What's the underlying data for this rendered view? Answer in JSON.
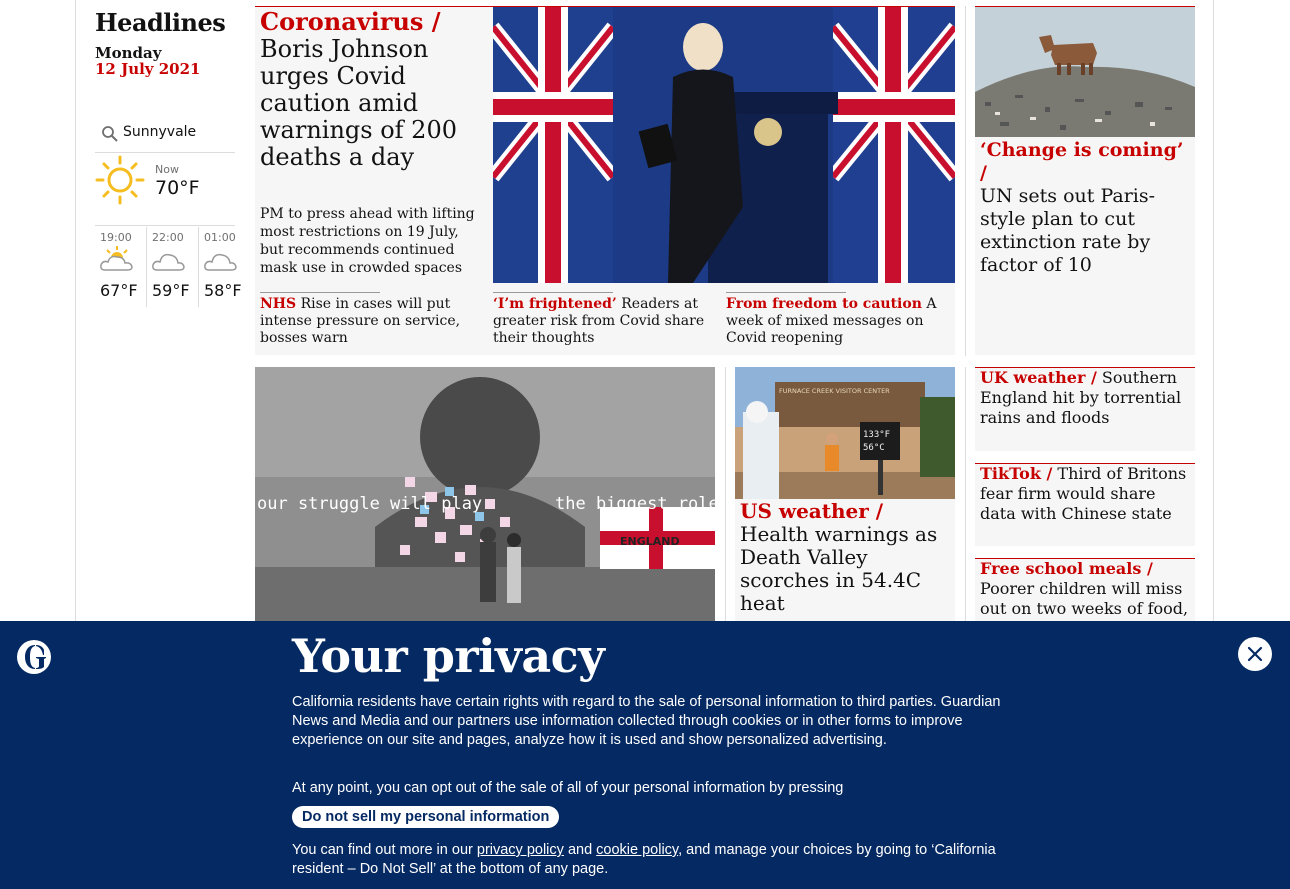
{
  "sidebar": {
    "title": "Headlines",
    "day": "Monday",
    "date": "12 July 2021",
    "location": "Sunnyvale",
    "now_label": "Now",
    "now_temp": "70°F",
    "now_icon": "sunny-icon",
    "forecast": [
      {
        "time": "19:00",
        "temp": "67°F",
        "icon": "partly-cloudy-icon"
      },
      {
        "time": "22:00",
        "temp": "59°F",
        "icon": "cloudy-night-icon"
      },
      {
        "time": "01:00",
        "temp": "58°F",
        "icon": "cloudy-night-icon"
      }
    ]
  },
  "main": {
    "lead": {
      "kicker": "Coronavirus /",
      "headline": "Boris Johnson urges Covid caution amid warnings of 200 deaths a day",
      "standfirst": "PM to press ahead with lifting most restrictions on 19 July, but recommends continued mask use in crowded spaces"
    },
    "sublinks": [
      {
        "kicker": "NHS",
        "text": "Rise in cases will put intense pressure on service, bosses warn"
      },
      {
        "kicker": "‘I’m frightened’",
        "text": "Readers at greater risk from Covid share their thoughts"
      },
      {
        "kicker": "From freedom to caution",
        "text": "A week of mixed messages on Covid reopening"
      }
    ],
    "mural_text_left": "our struggle will play",
    "mural_text_right": "the biggest role in your",
    "flag_text": "ENGLAND",
    "us_weather": {
      "kicker": "US weather /",
      "headline": "Health warnings as Death Valley scorches in 54.4C heat",
      "sign_text": "FURNACE CREEK VISITOR CENTER",
      "thermo_f": "133°F",
      "thermo_c": "56°C"
    }
  },
  "right": {
    "un": {
      "kicker": "‘Change is coming’ /",
      "headline": "UN sets out Paris-style plan to cut extinction rate by factor of 10"
    },
    "items": [
      {
        "kicker": "UK weather /",
        "headline": "Southern England hit by torrential rains and floods"
      },
      {
        "kicker": "TikTok /",
        "headline": "Third of Britons fear firm would share data with Chinese state"
      },
      {
        "kicker": "Free school meals /",
        "headline": "Poorer children will miss out on two weeks of food, says"
      }
    ]
  },
  "privacy": {
    "title": "Your privacy",
    "para1": "California residents have certain rights with regard to the sale of personal information to third parties. Guardian News and Media and our partners use information collected through cookies or in other forms to improve experience on our site and pages, analyze how it is used and show personalized advertising.",
    "para2": "At any point, you can opt out of the sale of all of your personal information by pressing",
    "button": "Do not sell my personal information",
    "para3_a": "You can find out more in our",
    "privacy_link": "privacy policy",
    "para3_b": "and",
    "cookie_link": "cookie policy",
    "para3_c": ", and manage your choices by going to ‘California resident – Do Not Sell’ at the bottom of any page.",
    "close_icon": "close-icon",
    "logo_icon": "guardian-logo-icon"
  },
  "colors": {
    "accent": "#c70000",
    "banner": "#052962"
  }
}
